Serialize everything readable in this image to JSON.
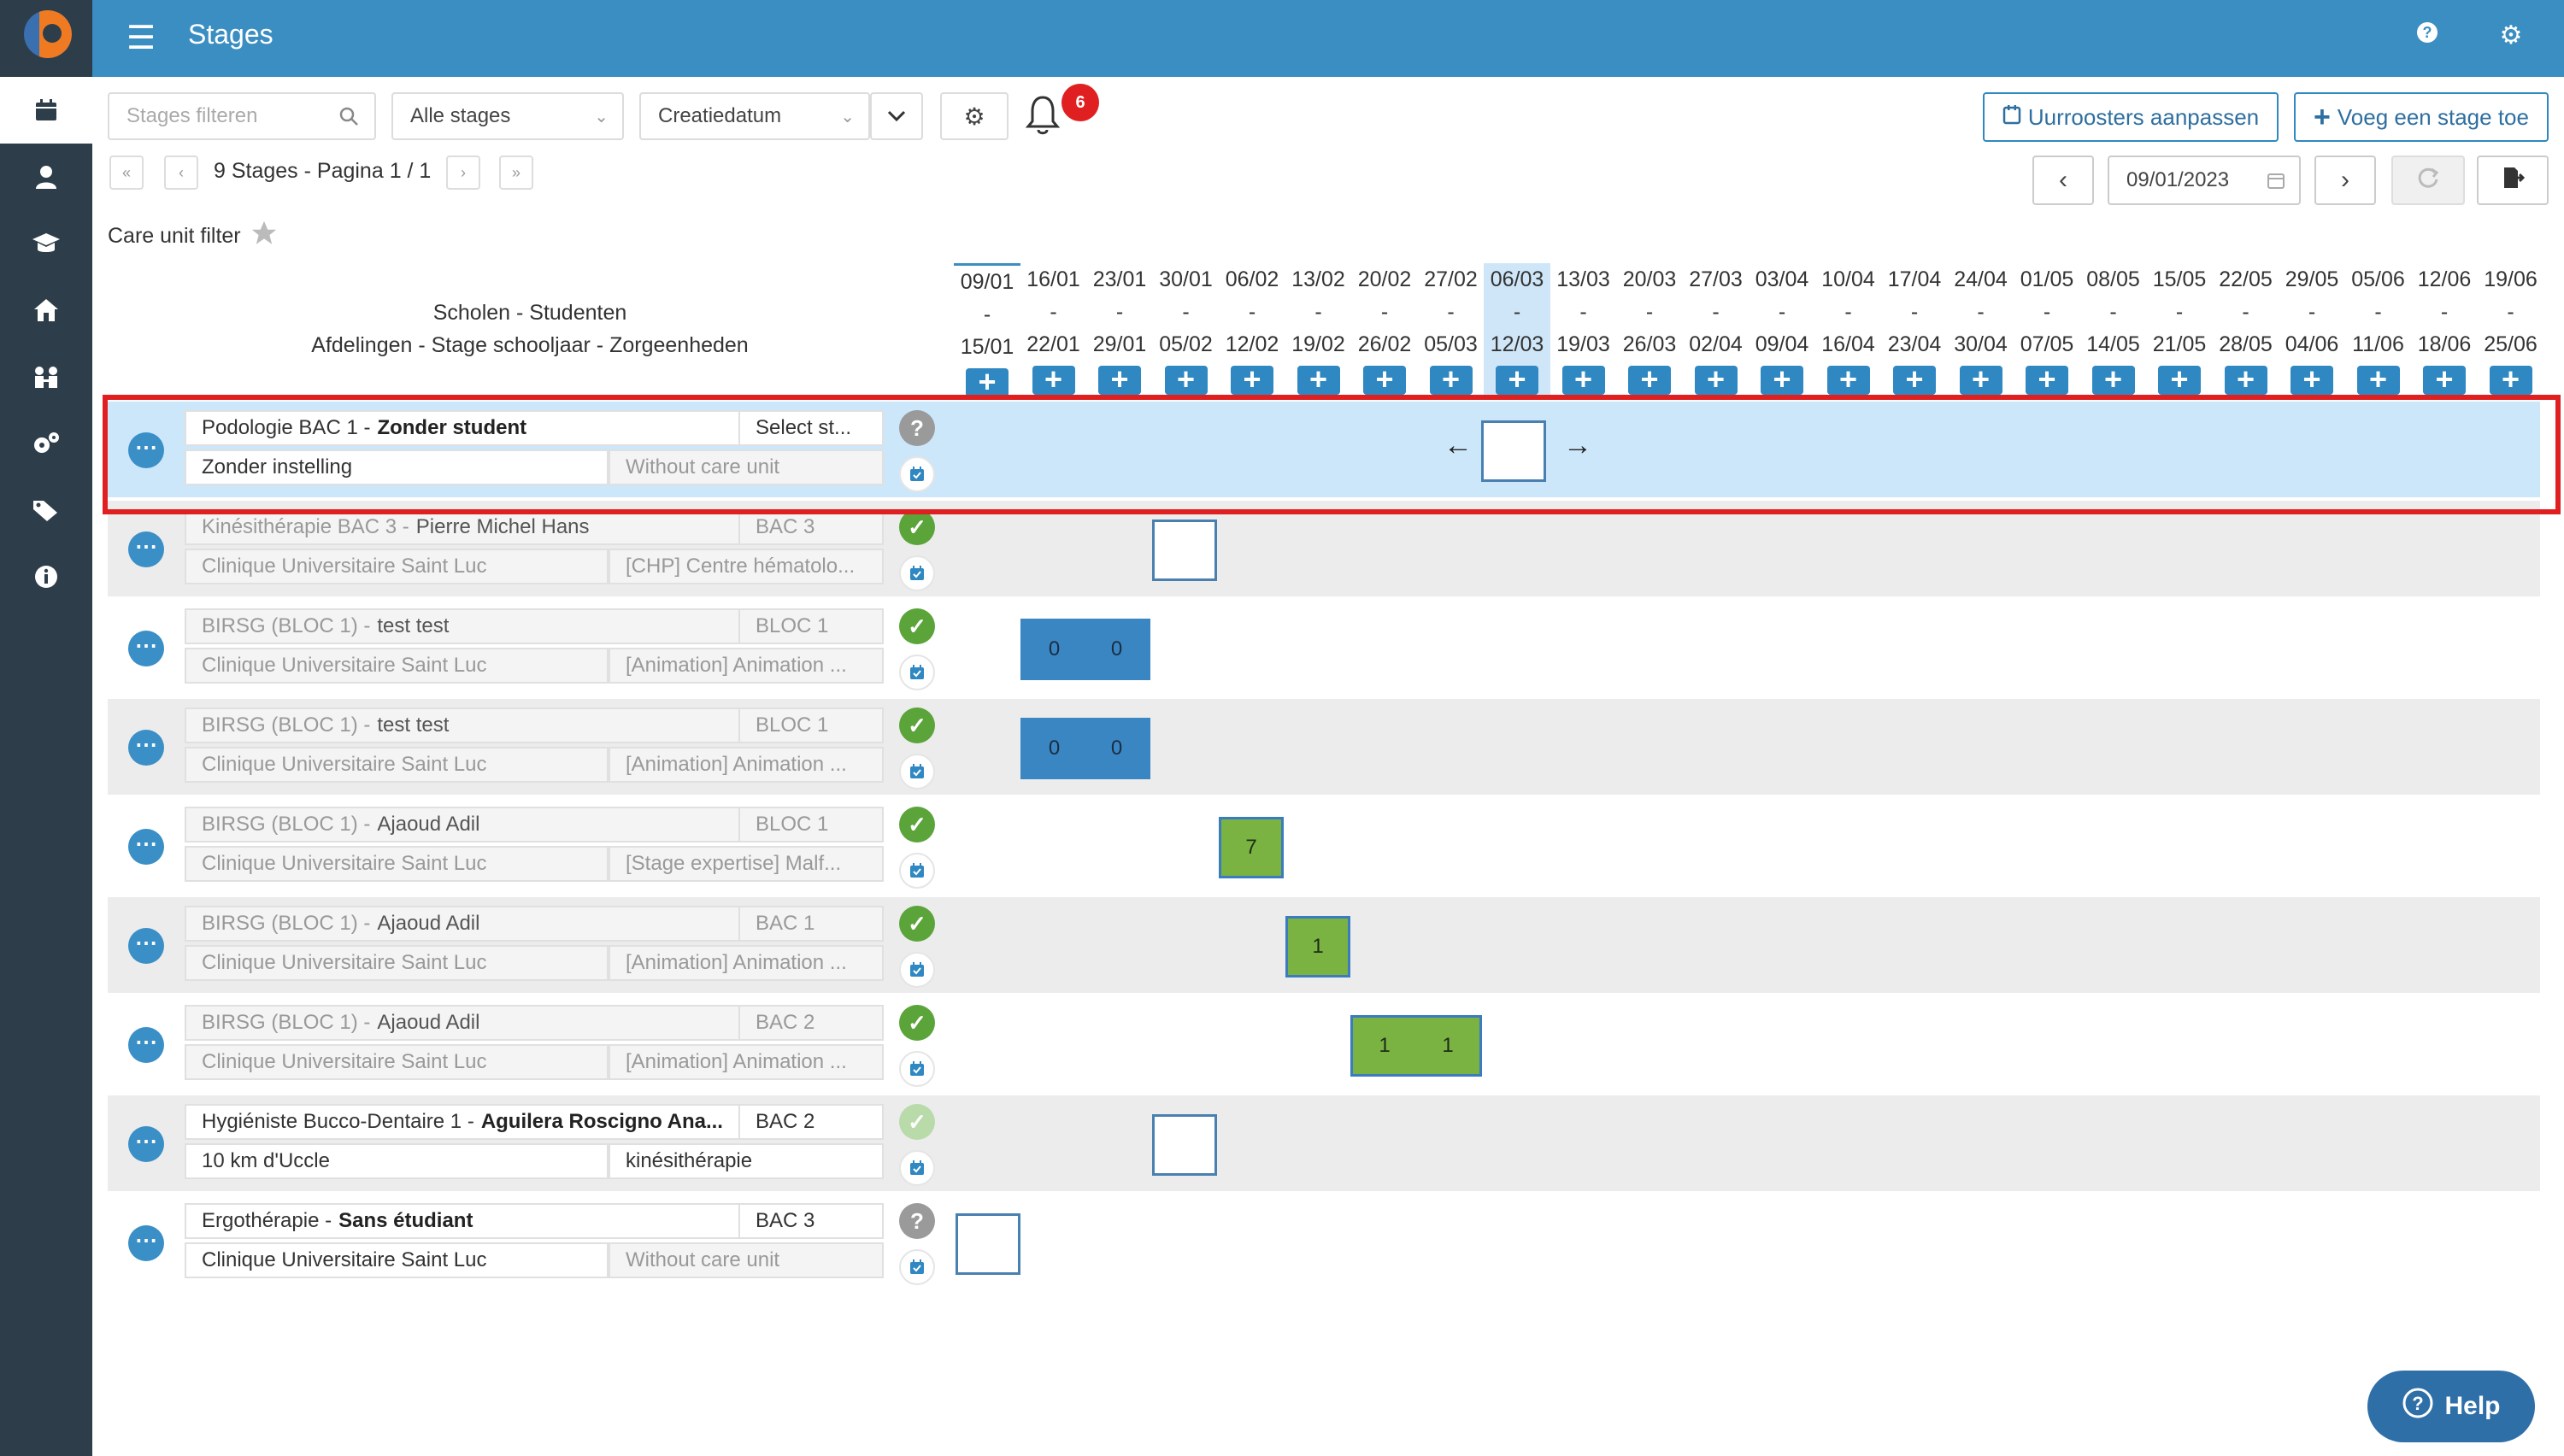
{
  "app": {
    "title": "Stages"
  },
  "toolbar": {
    "search_placeholder": "Stages filteren",
    "filter_select": "Alle stages",
    "sort_select": "Creatiedatum",
    "notification_count": "6",
    "schedules_button": "Uurroosters aanpassen",
    "add_stage_button": "Voeg een stage toe"
  },
  "pagination": {
    "text": "9 Stages - Pagina 1 / 1"
  },
  "date_picker": {
    "value": "09/01/2023"
  },
  "care_unit_filter": {
    "label": "Care unit filter"
  },
  "header_labels": {
    "line1": "Scholen - Studenten",
    "line2": "Afdelingen - Stage schooljaar - Zorgeenheden"
  },
  "weeks": [
    {
      "start": "09/01",
      "end": "15/01"
    },
    {
      "start": "16/01",
      "end": "22/01"
    },
    {
      "start": "23/01",
      "end": "29/01"
    },
    {
      "start": "30/01",
      "end": "05/02"
    },
    {
      "start": "06/02",
      "end": "12/02"
    },
    {
      "start": "13/02",
      "end": "19/02"
    },
    {
      "start": "20/02",
      "end": "26/02"
    },
    {
      "start": "27/02",
      "end": "05/03"
    },
    {
      "start": "06/03",
      "end": "12/03"
    },
    {
      "start": "13/03",
      "end": "19/03"
    },
    {
      "start": "20/03",
      "end": "26/03"
    },
    {
      "start": "27/03",
      "end": "02/04"
    },
    {
      "start": "03/04",
      "end": "09/04"
    },
    {
      "start": "10/04",
      "end": "16/04"
    },
    {
      "start": "17/04",
      "end": "23/04"
    },
    {
      "start": "24/04",
      "end": "30/04"
    },
    {
      "start": "01/05",
      "end": "07/05"
    },
    {
      "start": "08/05",
      "end": "14/05"
    },
    {
      "start": "15/05",
      "end": "21/05"
    },
    {
      "start": "22/05",
      "end": "28/05"
    },
    {
      "start": "29/05",
      "end": "04/06"
    },
    {
      "start": "05/06",
      "end": "11/06"
    },
    {
      "start": "12/06",
      "end": "18/06"
    },
    {
      "start": "19/06",
      "end": "25/06"
    }
  ],
  "week_separator": "-",
  "rows": [
    {
      "program": "Podologie BAC 1 -",
      "student": "Zonder student",
      "level": "Select st...",
      "institution": "Zonder instelling",
      "care_unit": "Without care unit",
      "status": "unknown"
    },
    {
      "program": "Kinésithérapie BAC 3 -",
      "student": "Pierre Michel Hans",
      "level": "BAC 3",
      "institution": "Clinique Universitaire Saint Luc",
      "care_unit": "[CHP] Centre hématolo...",
      "status": "ok"
    },
    {
      "program": "BIRSG (BLOC 1) -",
      "student": "test test",
      "level": "BLOC 1",
      "institution": "Clinique Universitaire Saint Luc",
      "care_unit": "[Animation] Animation ...",
      "status": "ok",
      "cells": [
        "0",
        "0"
      ]
    },
    {
      "program": "BIRSG (BLOC 1) -",
      "student": "test test",
      "level": "BLOC 1",
      "institution": "Clinique Universitaire Saint Luc",
      "care_unit": "[Animation] Animation ...",
      "status": "ok",
      "cells": [
        "0",
        "0"
      ]
    },
    {
      "program": "BIRSG (BLOC 1) -",
      "student": "Ajaoud Adil",
      "level": "BLOC 1",
      "institution": "Clinique Universitaire Saint Luc",
      "care_unit": "[Stage expertise] Malf...",
      "status": "ok",
      "cells": [
        "7"
      ]
    },
    {
      "program": "BIRSG (BLOC 1) -",
      "student": "Ajaoud Adil",
      "level": "BAC 1",
      "institution": "Clinique Universitaire Saint Luc",
      "care_unit": "[Animation] Animation ...",
      "status": "ok",
      "cells": [
        "1"
      ]
    },
    {
      "program": "BIRSG (BLOC 1) -",
      "student": "Ajaoud Adil",
      "level": "BAC 2",
      "institution": "Clinique Universitaire Saint Luc",
      "care_unit": "[Animation] Animation ...",
      "status": "ok",
      "cells": [
        "1",
        "1"
      ]
    },
    {
      "program": "Hygiéniste Bucco-Dentaire 1 -",
      "student": "Aguilera Roscigno Ana...",
      "level": "BAC 2",
      "institution": "10 km d'Uccle",
      "care_unit": "kinésithérapie",
      "status": "ok-light"
    },
    {
      "program": "Ergothérapie -",
      "student": "Sans étudiant",
      "level": "BAC 3",
      "institution": "Clinique Universitaire Saint Luc",
      "care_unit": "Without care unit",
      "status": "unknown"
    }
  ],
  "help": {
    "label": "Help"
  },
  "colors": {
    "primary": "#3b8ec2",
    "sidebar": "#2d3e4a",
    "green": "#7ab342",
    "highlight": "#cce6fa",
    "alert": "#e02020"
  }
}
